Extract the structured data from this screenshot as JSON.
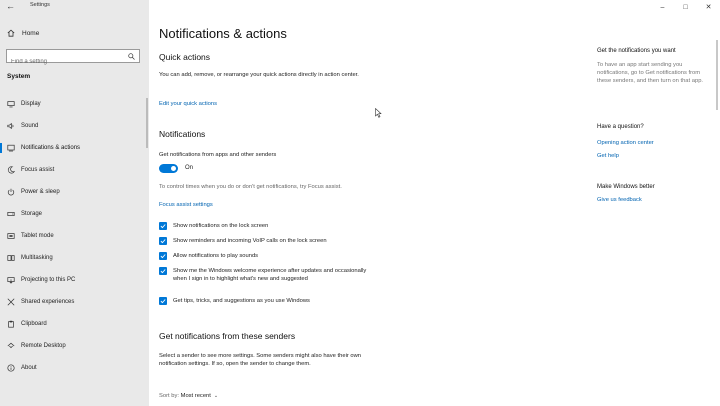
{
  "window": {
    "title": "Settings",
    "controls": {
      "minimize": "–",
      "maximize": "□",
      "close": "✕"
    }
  },
  "sidebar": {
    "home_label": "Home",
    "search_placeholder": "Find a setting",
    "section_title": "System",
    "items": [
      {
        "label": "Display",
        "icon": "display-icon"
      },
      {
        "label": "Sound",
        "icon": "speaker-icon"
      },
      {
        "label": "Notifications & actions",
        "icon": "notification-icon",
        "active": true
      },
      {
        "label": "Focus assist",
        "icon": "moon-icon"
      },
      {
        "label": "Power & sleep",
        "icon": "power-icon"
      },
      {
        "label": "Storage",
        "icon": "storage-icon"
      },
      {
        "label": "Tablet mode",
        "icon": "tablet-icon"
      },
      {
        "label": "Multitasking",
        "icon": "multitasking-icon"
      },
      {
        "label": "Projecting to this PC",
        "icon": "projector-icon"
      },
      {
        "label": "Shared experiences",
        "icon": "shared-icon"
      },
      {
        "label": "Clipboard",
        "icon": "clipboard-icon"
      },
      {
        "label": "Remote Desktop",
        "icon": "remote-desktop-icon"
      },
      {
        "label": "About",
        "icon": "info-icon"
      }
    ]
  },
  "main": {
    "title": "Notifications & actions",
    "quick_actions": {
      "heading": "Quick actions",
      "description": "You can add, remove, or rearrange your quick actions directly in action center.",
      "link": "Edit your quick actions"
    },
    "notifications": {
      "heading": "Notifications",
      "toggle_caption": "Get notifications from apps and other senders",
      "toggle_state": "On",
      "focus_text": "To control times when you do or don't get notifications, try Focus assist.",
      "focus_link": "Focus assist settings",
      "checkboxes": [
        {
          "label": "Show notifications on the lock screen",
          "checked": true
        },
        {
          "label": "Show reminders and incoming VoIP calls on the lock screen",
          "checked": true
        },
        {
          "label": "Allow notifications to play sounds",
          "checked": true
        },
        {
          "label": "Show me the Windows welcome experience after updates and occasionally when I sign in to highlight what's new and suggested",
          "checked": true
        },
        {
          "label": "Get tips, tricks, and suggestions as you use Windows",
          "checked": true
        }
      ]
    },
    "senders": {
      "heading": "Get notifications from these senders",
      "description": "Select a sender to see more settings. Some senders might also have their own notification settings. If so, open the sender to change them.",
      "sort_label": "Sort by:",
      "sort_value": "Most recent"
    }
  },
  "rail": {
    "want_heading": "Get the notifications you want",
    "want_text": "To have an app start sending you notifications, go to Get notifications from these senders, and then turn on that app.",
    "question_heading": "Have a question?",
    "question_links": [
      "Opening action center",
      "Get help"
    ],
    "better_heading": "Make Windows better",
    "feedback_link": "Give us feedback"
  },
  "colors": {
    "accent": "#0078d7",
    "link": "#0063b1",
    "sidebar_bg": "#e9e9e9"
  }
}
